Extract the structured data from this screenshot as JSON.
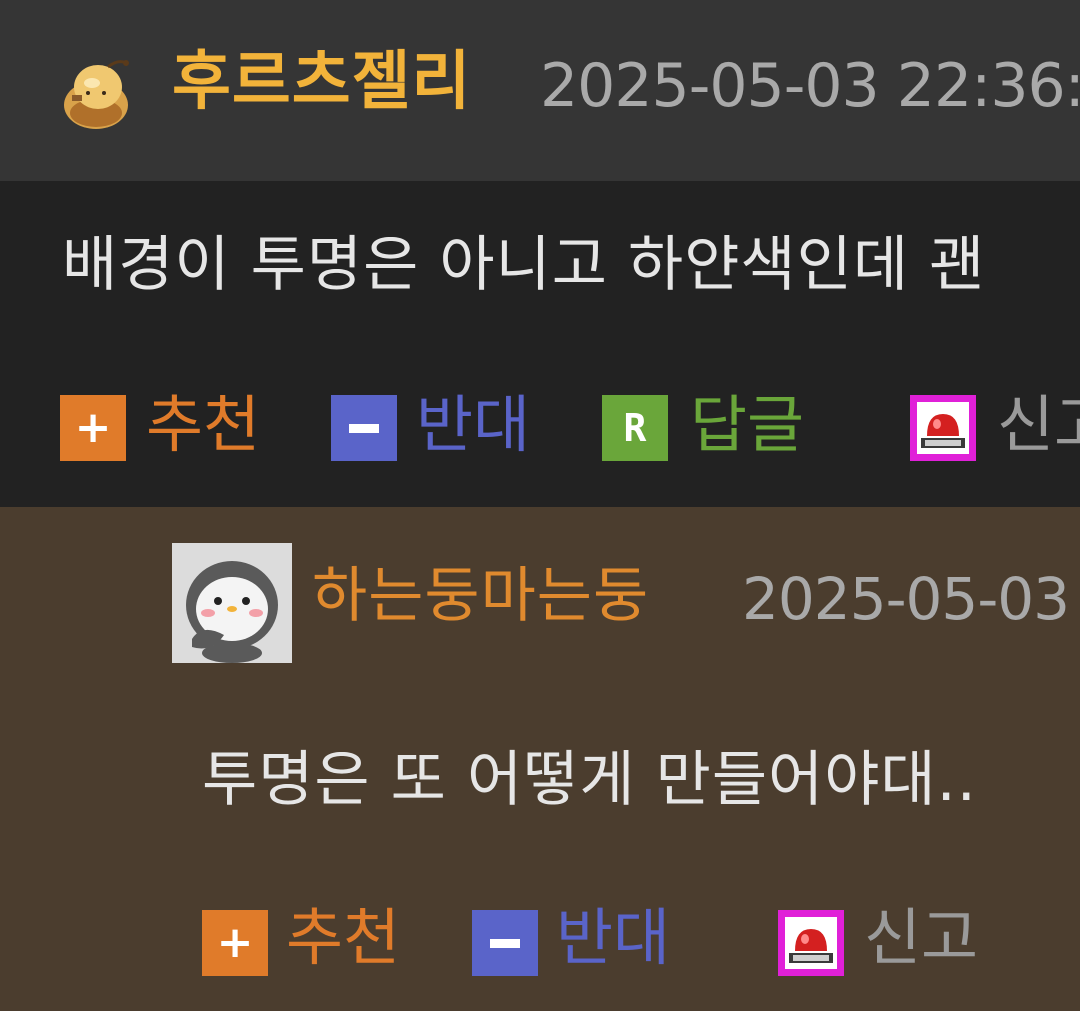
{
  "comment": {
    "nickname": "후르츠젤리",
    "date": "2025-05-03 22:36:",
    "text": "배경이 투명은 아니고 하얀색인데 괜",
    "avatar_icon": "jelly-character-icon",
    "actions": {
      "recommend_label": "추천",
      "oppose_label": "반대",
      "reply_label": "답글",
      "report_label": "신고"
    }
  },
  "reply": {
    "nickname": "하는둥마는둥",
    "date": "2025-05-03",
    "text": "투명은 또 어떻게 만들어야대..",
    "avatar_icon": "penguin-icon",
    "actions": {
      "recommend_label": "추천",
      "oppose_label": "반대",
      "report_label": "신고"
    }
  },
  "colors": {
    "header_bg": "#353535",
    "comment_bg": "#222222",
    "reply_bg": "#4b3d2e",
    "nickname1": "#f2b33a",
    "nickname2": "#e08a2e",
    "recommend": "#e07b2a",
    "oppose": "#5a64c9",
    "reply_action": "#6aa63a",
    "report_icon": "#e020d8"
  }
}
